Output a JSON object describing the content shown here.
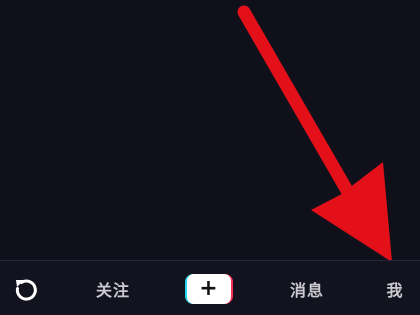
{
  "annotation": {
    "arrow_color": "#e3101a"
  },
  "tabbar": {
    "refresh_icon": "refresh-icon",
    "follow_label": "关注",
    "create_icon": "plus-icon",
    "create_symbol": "+",
    "messages_label": "消息",
    "me_label": "我"
  },
  "colors": {
    "background": "#10101b",
    "tab_text": "#c9c9cf",
    "brand_cyan": "#20d5ec",
    "brand_pink": "#fe2c55"
  }
}
